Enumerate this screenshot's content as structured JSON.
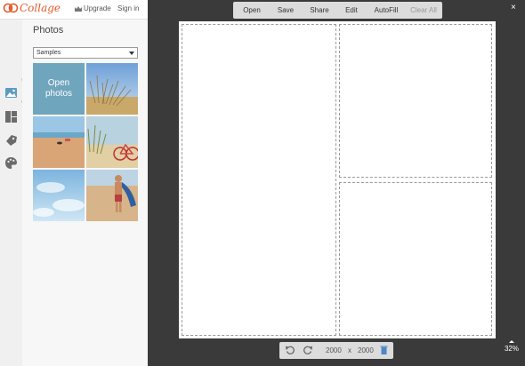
{
  "header": {
    "logo_text": "Collage",
    "upgrade_label": "Upgrade",
    "signin_label": "Sign in"
  },
  "sidebar": {
    "rail_icons": [
      "photos-icon",
      "layouts-icon",
      "stickers-icon",
      "palette-icon"
    ],
    "panel_title": "Photos",
    "source_select": {
      "selected": "Samples"
    },
    "open_photos_label": "Open photos",
    "photos": [
      {
        "name": "open-photos-tile"
      },
      {
        "name": "dune-grass-photo"
      },
      {
        "name": "beach-photo"
      },
      {
        "name": "bicycle-dune-photo"
      },
      {
        "name": "sky-clouds-photo"
      },
      {
        "name": "boy-on-beach-photo"
      }
    ]
  },
  "toolbar": {
    "open": "Open",
    "save": "Save",
    "share": "Share",
    "edit": "Edit",
    "autofill": "AutoFill",
    "clear_all": "Clear All"
  },
  "close_label": "×",
  "canvas": {
    "width_value": "2000",
    "times": "x",
    "height_value": "2000"
  },
  "zoom_level": "32%",
  "colors": {
    "brand": "#e55a2b",
    "open_tile": "#6fa5bd",
    "workspace": "#3a3a3a"
  }
}
